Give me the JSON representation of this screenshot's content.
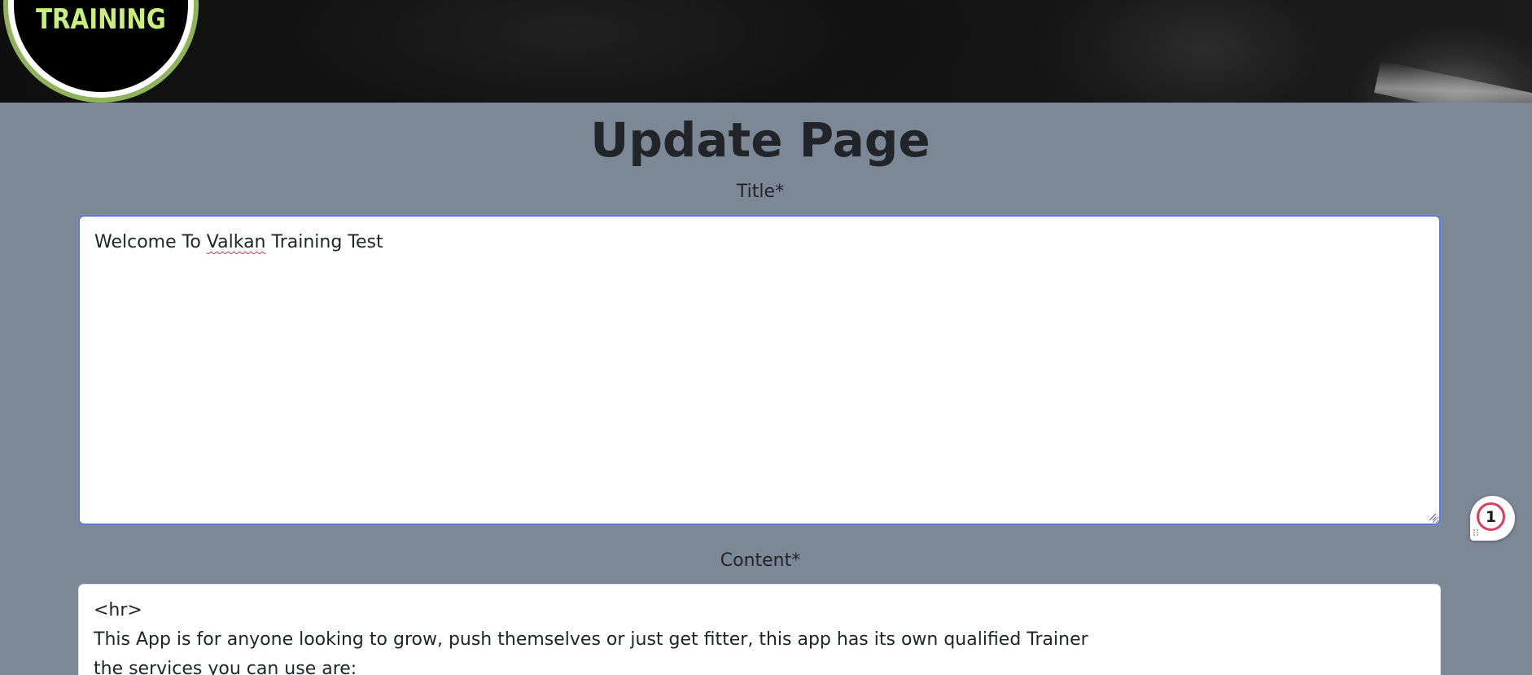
{
  "header": {
    "logo_text": "TRAINING"
  },
  "form": {
    "heading": "Update Page",
    "title_label": "Title*",
    "title_value_before": "Welcome To ",
    "title_value_misspelled": "Valkan",
    "title_value_after": " Training Test",
    "content_label": "Content*",
    "content_lines": [
      "<hr>",
      "This App is for anyone looking to grow, push themselves or just get fitter, this app has its own qualified Trainer",
      "the services you can use are:"
    ]
  },
  "badge": {
    "count": "1",
    "icon": "notification-badge-icon"
  },
  "colors": {
    "page_bg": "#7d8896",
    "logo_text": "#c8f07a",
    "logo_outer": "#8fb35a",
    "focus_border": "#5b78d2",
    "badge_ring": "#e03a5c"
  }
}
